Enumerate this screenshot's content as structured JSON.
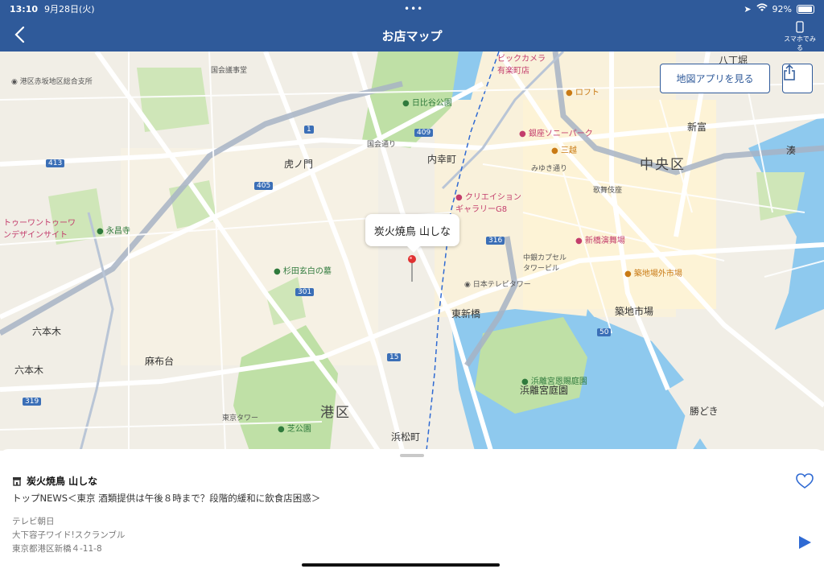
{
  "status": {
    "time": "13:10",
    "date": "9月28日(火)",
    "battery": "92%",
    "battery_level": 0.92
  },
  "nav": {
    "title": "お店マップ",
    "phone_label": "スマホでみる"
  },
  "map": {
    "map_app_button": "地図アプリを見る",
    "callout": "炭火焼鳥 山しな",
    "labels": {
      "minato": "港区",
      "chuo": "中央区",
      "toranomon": "虎ノ門",
      "uchisaiwaicho": "内幸町",
      "shinbashi_east": "東新橋",
      "roppongi": "六本木",
      "roppongi2": "六本木",
      "azabudai": "麻布台",
      "hamamatsucho": "浜松町",
      "tsukiji": "築地市場",
      "kachidoki": "勝どき",
      "shintomi": "新富",
      "minato2": "湊",
      "hatchobori": "八丁堀",
      "hibiya_park": "日比谷公園",
      "hamarikyu": "浜離宮庭園",
      "shiba_park": "芝公園",
      "sugita": "杉田玄白の墓",
      "nittele": "日本テレビタワー",
      "sony": "銀座ソニーパーク",
      "mitsukoshi": "三越",
      "loft": "ロフト",
      "creation": "クリエイション\nギャラリーG8",
      "shinbashi_enbujo": "新橋演舞場",
      "tsukiji_outer": "築地場外市場",
      "nakagin": "中銀カプセル\nタワービル",
      "kabukiza": "歌舞伎座",
      "tokyo_tower": "東京タワー",
      "akasaka_office": "港区赤坂地区総合支所",
      "diet": "国会議事堂",
      "eishoji": "永昌寺",
      "kokkai_dori": "国会通り",
      "hamarikyu_small": "浜離宮恩賜庭園",
      "toranomon_tower": "トゥーワントゥーワ\nンデザインサイト",
      "miyuki": "みゆき通り",
      "yurakucho": "ビックカメラ\n有楽町店"
    },
    "route_shields": [
      "1",
      "409",
      "405",
      "413",
      "301",
      "316",
      "15",
      "319",
      "50"
    ]
  },
  "sheet": {
    "shop_name": "炭火焼鳥 山しな",
    "news": "トップNEWS＜東京 酒類提供は午後８時まで？段階的緩和に飲食店困惑＞",
    "station": "テレビ朝日",
    "program": "大下容子ワイド!スクランブル",
    "address": "東京都港区新橋４-11-8"
  },
  "colors": {
    "brand": "#2f5a9a",
    "park": "#bfe0a6",
    "water": "#8ec9ee",
    "road": "#ffffff",
    "pin": "#e03131"
  }
}
